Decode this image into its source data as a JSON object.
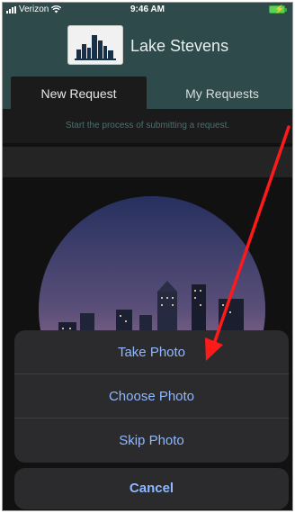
{
  "status_bar": {
    "carrier": "Verizon",
    "time": "9:46 AM"
  },
  "header": {
    "title": "Lake Stevens"
  },
  "tabs": [
    {
      "label": "New Request",
      "active": true
    },
    {
      "label": "My Requests",
      "active": false
    }
  ],
  "subtitle": "Start the process of submitting a request.",
  "action_sheet": {
    "items": [
      {
        "label": "Take Photo"
      },
      {
        "label": "Choose Photo"
      },
      {
        "label": "Skip Photo"
      }
    ],
    "cancel_label": "Cancel"
  },
  "colors": {
    "header_bg": "#2f4a4a",
    "action_text": "#8fb8ff",
    "annotation_arrow": "#ff1a1a"
  },
  "icons": [
    "wifi-icon",
    "battery-icon",
    "city-skyline-logo",
    "red-annotation-arrow"
  ]
}
